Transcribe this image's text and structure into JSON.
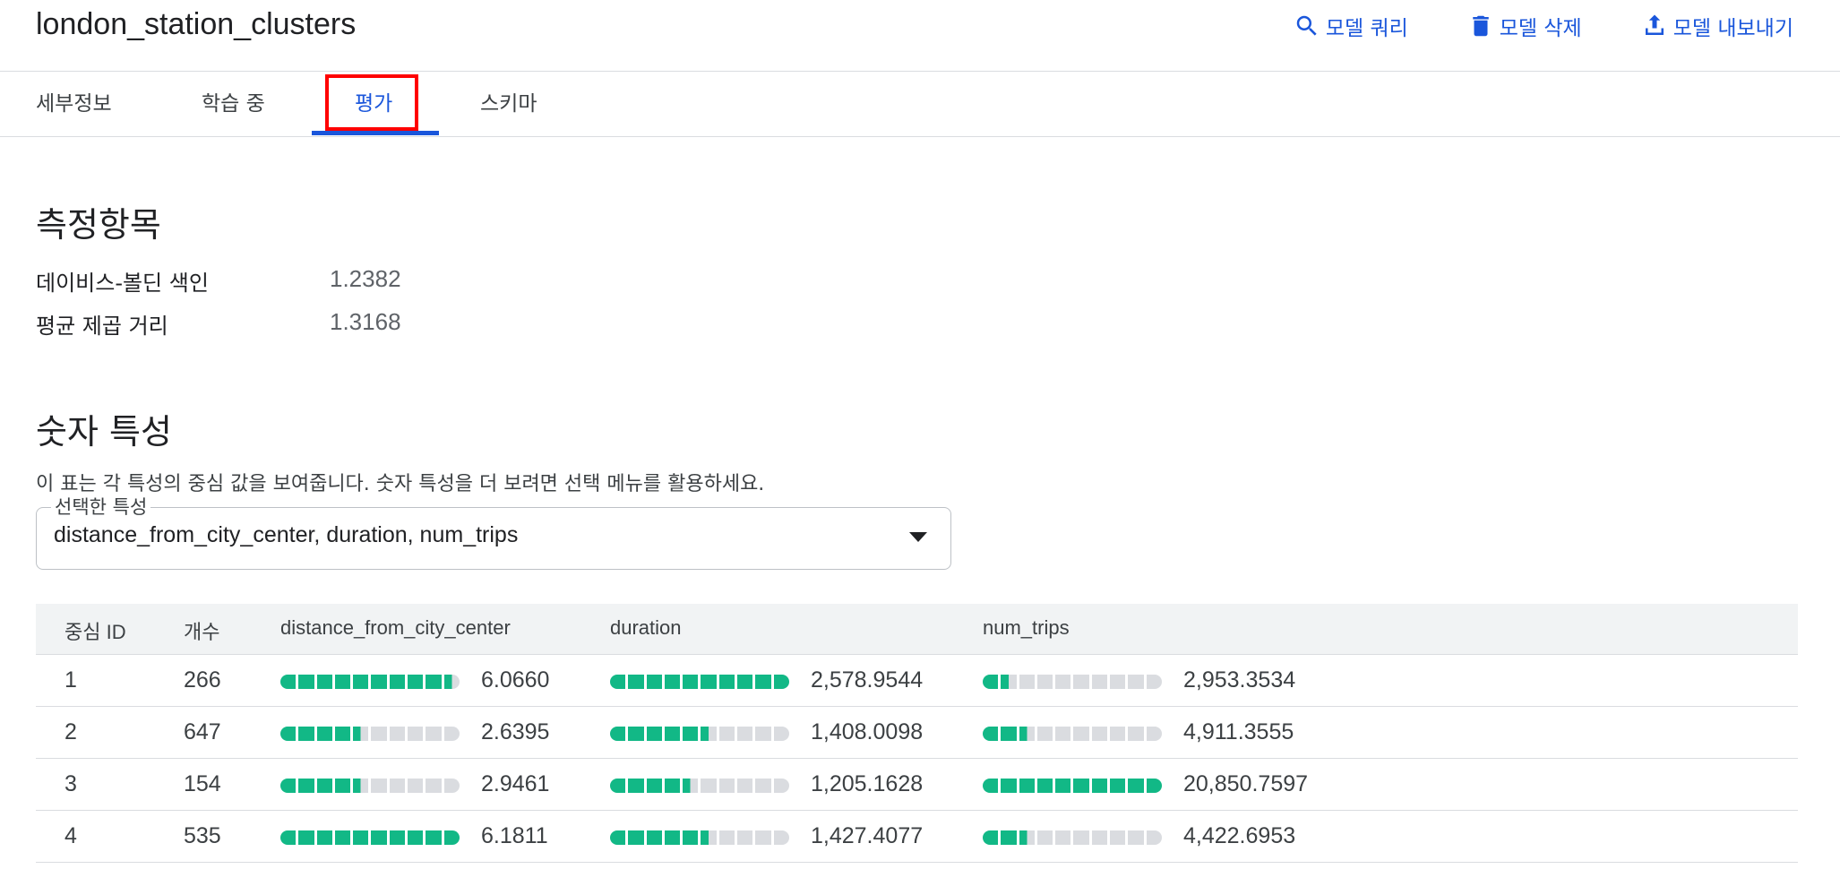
{
  "header": {
    "title": "london_station_clusters",
    "actions": [
      {
        "label": "모델 쿼리",
        "icon": "search-icon"
      },
      {
        "label": "모델 삭제",
        "icon": "trash-icon"
      },
      {
        "label": "모델 내보내기",
        "icon": "export-icon"
      }
    ]
  },
  "tabs": [
    {
      "label": "세부정보"
    },
    {
      "label": "학습 중"
    },
    {
      "label": "평가",
      "active": true
    },
    {
      "label": "스키마"
    }
  ],
  "metrics": {
    "title": "측정항목",
    "rows": [
      {
        "label": "데이비스-볼딘 색인",
        "value": "1.2382"
      },
      {
        "label": "평균 제곱 거리",
        "value": "1.3168"
      }
    ]
  },
  "numeric_features": {
    "title": "숫자 특성",
    "description": "이 표는 각 특성의 중심 값을 보여줍니다. 숫자 특성을 더 보려면 선택 메뉴를 활용하세요.",
    "select": {
      "legend": "선택한 특성",
      "value": "distance_from_city_center, duration, num_trips"
    },
    "table": {
      "headers": [
        "중심 ID",
        "개수",
        "distance_from_city_center",
        "duration",
        "num_trips"
      ],
      "rows": [
        {
          "id": "1",
          "count": "266",
          "distance": "6.0660",
          "distance_level": 0.98,
          "duration": "2,578.9544",
          "duration_level": 1.0,
          "num_trips": "2,953.3534",
          "num_trips_level": 0.14
        },
        {
          "id": "2",
          "count": "647",
          "distance": "2.6395",
          "distance_level": 0.43,
          "duration": "1,408.0098",
          "duration_level": 0.55,
          "num_trips": "4,911.3555",
          "num_trips_level": 0.24
        },
        {
          "id": "3",
          "count": "154",
          "distance": "2.9461",
          "distance_level": 0.48,
          "duration": "1,205.1628",
          "duration_level": 0.47,
          "num_trips": "20,850.7597",
          "num_trips_level": 1.0
        },
        {
          "id": "4",
          "count": "535",
          "distance": "6.1811",
          "distance_level": 1.0,
          "duration": "1,427.4077",
          "duration_level": 0.55,
          "num_trips": "4,422.6953",
          "num_trips_level": 0.21
        }
      ]
    }
  },
  "colors": {
    "accent": "#1a56db",
    "bar_fill": "#12b886",
    "bar_empty": "#dadce0",
    "highlight": "#ff0000"
  }
}
